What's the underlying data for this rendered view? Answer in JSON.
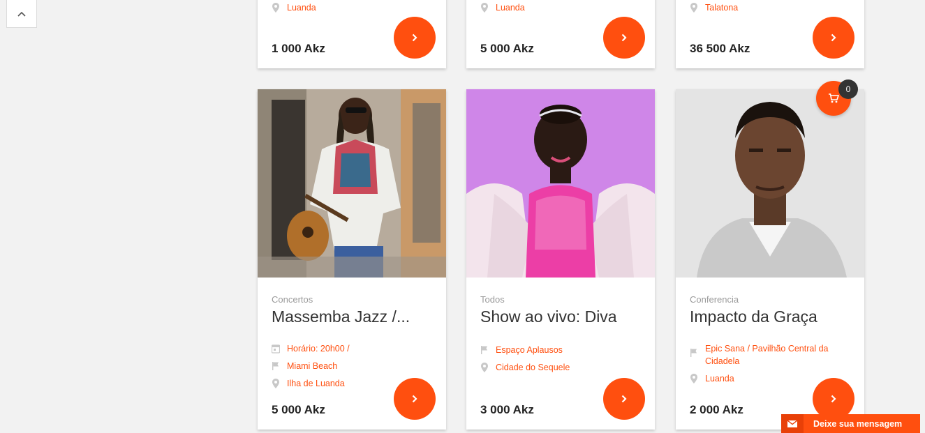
{
  "top_cards": [
    {
      "location": "Luanda",
      "price": "1 000 Akz"
    },
    {
      "location": "Luanda",
      "price": "5 000 Akz"
    },
    {
      "location": "Talatona",
      "price": "36 500 Akz"
    }
  ],
  "events": [
    {
      "category": "Concertos",
      "title": "Massemba Jazz /...",
      "meta": [
        {
          "icon": "calendar-icon",
          "text": "Horário: 20h00 /"
        },
        {
          "icon": "flag-icon",
          "text": "Miami Beach"
        },
        {
          "icon": "location-pin-icon",
          "text": "Ilha de Luanda"
        }
      ],
      "price": "5 000 Akz"
    },
    {
      "category": "Todos",
      "title": "Show ao vivo: Diva",
      "meta": [
        {
          "icon": "flag-icon",
          "text": "Espaço Aplausos"
        },
        {
          "icon": "location-pin-icon",
          "text": "Cidade do Sequele"
        }
      ],
      "price": "3 000 Akz"
    },
    {
      "category": "Conferencia",
      "title": "Impacto da Graça",
      "meta": [
        {
          "icon": "flag-icon",
          "text": "Epic Sana / Pavilhão Central da Cidadela"
        },
        {
          "icon": "location-pin-icon",
          "text": "Luanda"
        }
      ],
      "price": "2 000 Akz"
    }
  ],
  "cart": {
    "count": "0"
  },
  "message_bar": {
    "label": "Deixe sua mensagem"
  },
  "colors": {
    "accent": "#ff4f0f",
    "background": "#f2f2f2"
  }
}
